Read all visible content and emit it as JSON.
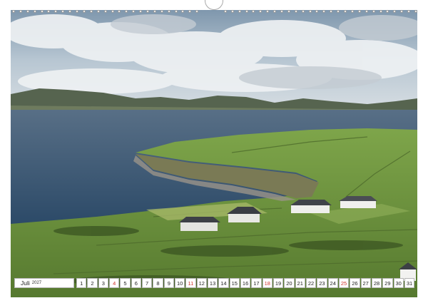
{
  "calendar": {
    "month": "Juli",
    "year": "2027",
    "days": [
      {
        "d": "1",
        "sunday": false
      },
      {
        "d": "2",
        "sunday": false
      },
      {
        "d": "3",
        "sunday": false
      },
      {
        "d": "4",
        "sunday": true
      },
      {
        "d": "5",
        "sunday": false
      },
      {
        "d": "6",
        "sunday": false
      },
      {
        "d": "7",
        "sunday": false
      },
      {
        "d": "8",
        "sunday": false
      },
      {
        "d": "9",
        "sunday": false
      },
      {
        "d": "10",
        "sunday": false
      },
      {
        "d": "11",
        "sunday": true
      },
      {
        "d": "12",
        "sunday": false
      },
      {
        "d": "13",
        "sunday": false
      },
      {
        "d": "14",
        "sunday": false
      },
      {
        "d": "15",
        "sunday": false
      },
      {
        "d": "16",
        "sunday": false
      },
      {
        "d": "17",
        "sunday": false
      },
      {
        "d": "18",
        "sunday": true
      },
      {
        "d": "19",
        "sunday": false
      },
      {
        "d": "20",
        "sunday": false
      },
      {
        "d": "21",
        "sunday": false
      },
      {
        "d": "22",
        "sunday": false
      },
      {
        "d": "23",
        "sunday": false
      },
      {
        "d": "24",
        "sunday": false
      },
      {
        "d": "25",
        "sunday": true
      },
      {
        "d": "26",
        "sunday": false
      },
      {
        "d": "27",
        "sunday": false
      },
      {
        "d": "28",
        "sunday": false
      },
      {
        "d": "29",
        "sunday": false
      },
      {
        "d": "30",
        "sunday": false
      },
      {
        "d": "31",
        "sunday": false
      }
    ]
  },
  "colors": {
    "sunday_text": "#d0342c",
    "sky": "#a9bccd",
    "sea": "#3d5a78",
    "grass": "#6f9a3c",
    "hills": "#4f5e4a"
  },
  "binding": {
    "ring_count": 58,
    "icon": "spiral-binding-icon"
  }
}
